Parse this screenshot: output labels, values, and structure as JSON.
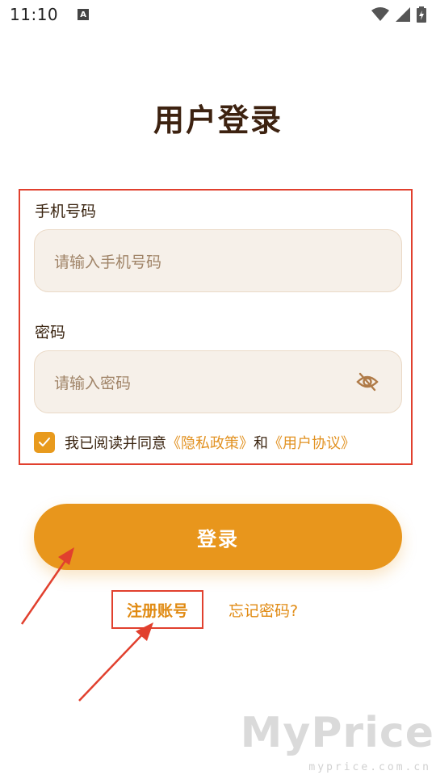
{
  "status_bar": {
    "time": "11:10",
    "notification_badge": "A",
    "icons": [
      "wifi-icon",
      "signal-icon",
      "battery-charging-icon"
    ]
  },
  "page": {
    "title": "用户登录"
  },
  "form": {
    "phone_label": "手机号码",
    "phone_placeholder": "请输入手机号码",
    "password_label": "密码",
    "password_placeholder": "请输入密码",
    "agree_text": "我已阅读并同意",
    "privacy_link": "《隐私政策》",
    "and_text": "和",
    "agreement_link": "《用户协议》",
    "agree_checked": true
  },
  "actions": {
    "login_label": "登录",
    "register_label": "注册账号",
    "forgot_label": "忘记密码?"
  },
  "watermark": {
    "brand": "MyPrice",
    "url": "myprice.com.cn"
  },
  "colors": {
    "accent": "#e8961c",
    "highlight_border": "#e1402e",
    "input_bg": "#f6f0e9",
    "title": "#3d2210"
  }
}
